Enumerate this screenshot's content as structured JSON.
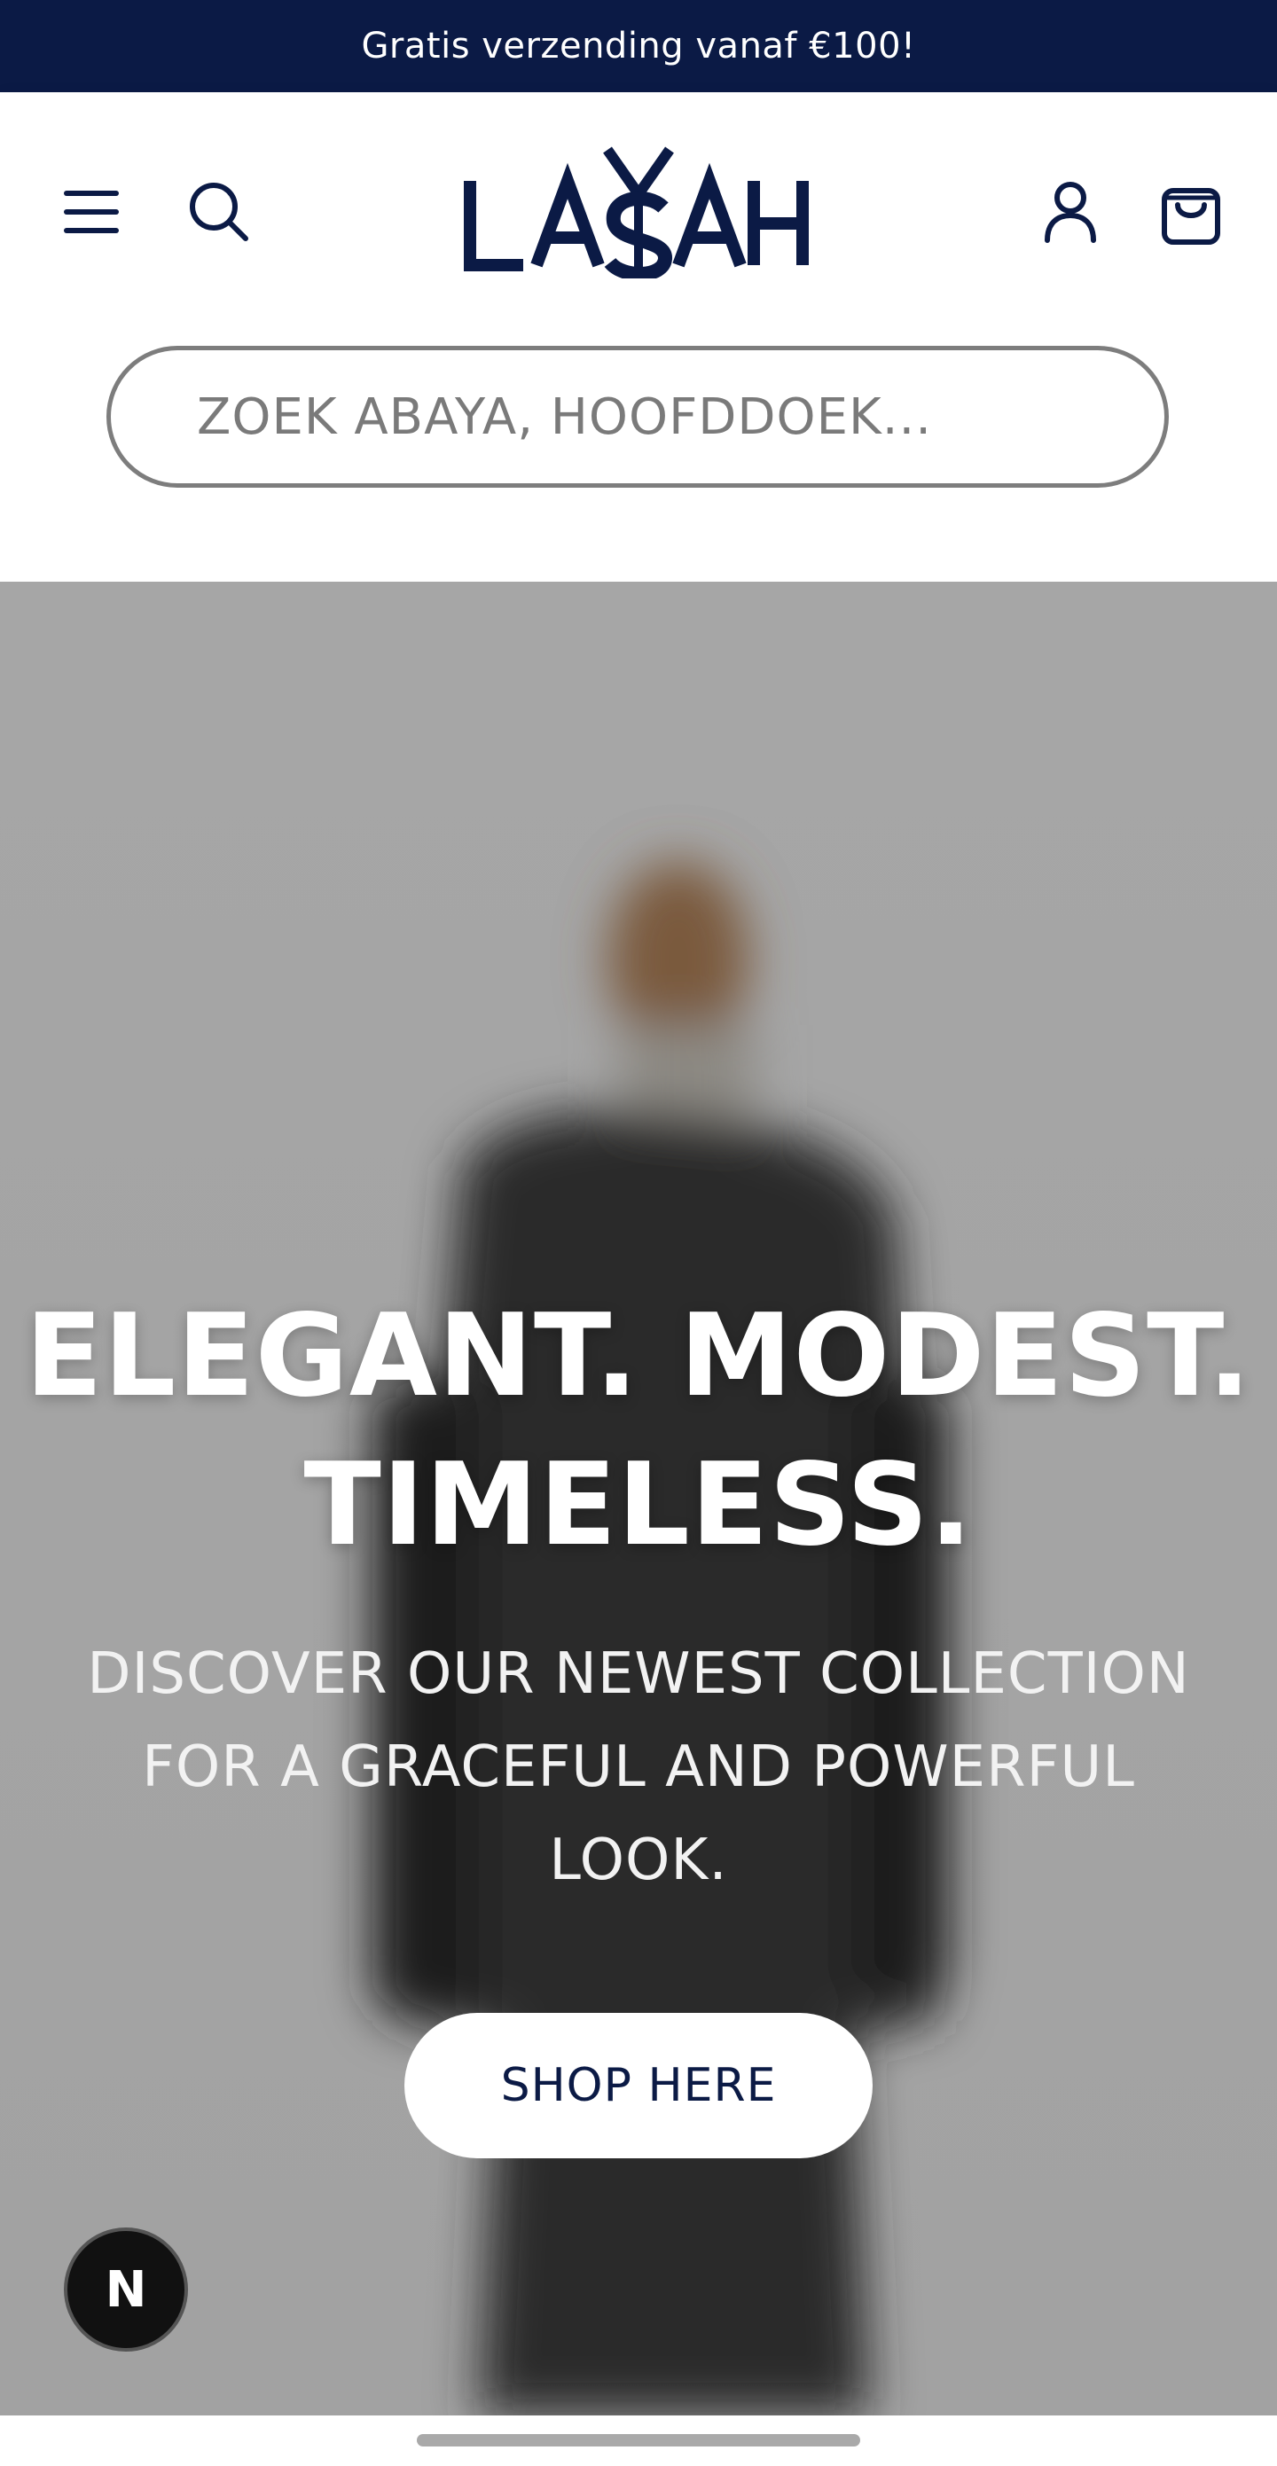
{
  "announcement": {
    "text": "Gratis verzending vanaf €100!"
  },
  "header": {
    "logo_text": "LASAH",
    "search": {
      "placeholder": "ZOEK ABAYA, HOOFDDOEK..."
    },
    "icons": {
      "menu": "menu-icon",
      "search": "search-icon",
      "account": "user-icon",
      "cart": "shopping-bag-icon"
    }
  },
  "hero": {
    "title_line1": "ELEGANT. MODEST.",
    "title_line2": "TIMELESS.",
    "subtitle": "DISCOVER OUR NEWEST COLLECTION FOR A GRACEFUL AND POWERFUL LOOK.",
    "cta_label": "SHOP HERE"
  },
  "floating_button": {
    "label": "N"
  },
  "colors": {
    "brand_navy": "#0b1a45",
    "hero_bg": "#a9a9a9",
    "white": "#ffffff"
  }
}
